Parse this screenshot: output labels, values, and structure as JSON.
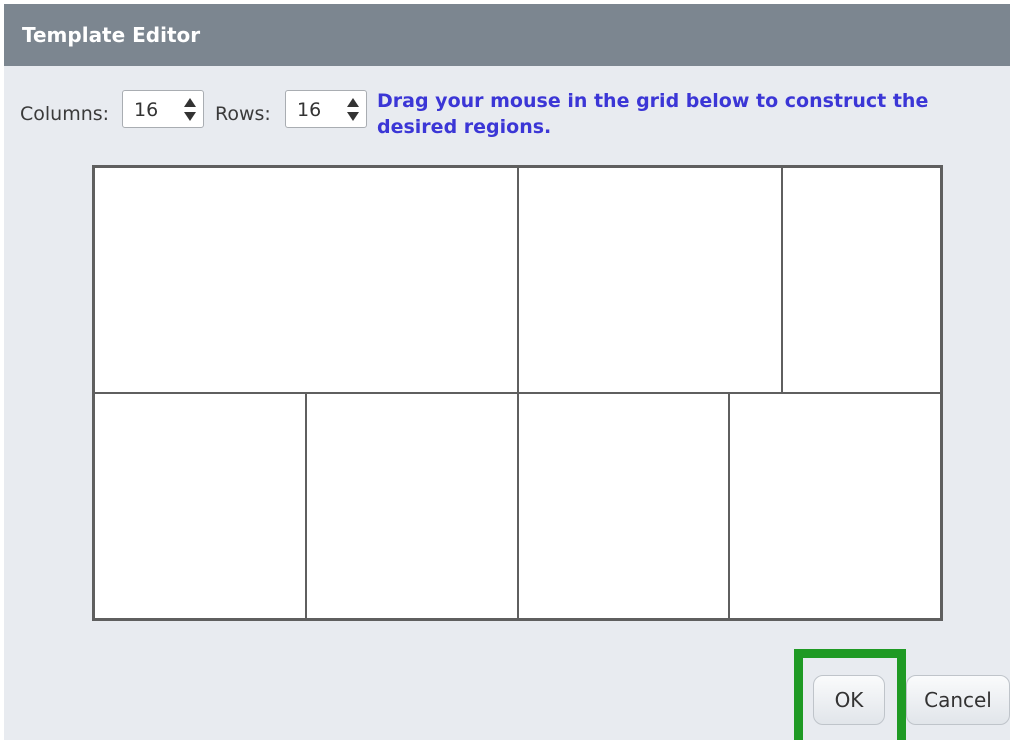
{
  "dialog": {
    "title": "Template Editor"
  },
  "controls": {
    "columns_label": "Columns:",
    "columns_value": "16",
    "rows_label": "Rows:",
    "rows_value": "16",
    "instruction": "Drag your mouse in the grid below to construct the desired regions."
  },
  "grid": {
    "columns": 16,
    "rows": 16,
    "regions": [
      {
        "col": 0,
        "row": 0,
        "colspan": 8,
        "rowspan": 8
      },
      {
        "col": 8,
        "row": 0,
        "colspan": 5,
        "rowspan": 8
      },
      {
        "col": 13,
        "row": 0,
        "colspan": 3,
        "rowspan": 8
      },
      {
        "col": 0,
        "row": 8,
        "colspan": 4,
        "rowspan": 8
      },
      {
        "col": 4,
        "row": 8,
        "colspan": 4,
        "rowspan": 8
      },
      {
        "col": 8,
        "row": 8,
        "colspan": 4,
        "rowspan": 8
      },
      {
        "col": 12,
        "row": 8,
        "colspan": 4,
        "rowspan": 8
      }
    ]
  },
  "buttons": {
    "ok_label": "OK",
    "cancel_label": "Cancel"
  },
  "colors": {
    "titlebar": "#7c8690",
    "dialog_background": "#e8ebf0",
    "instruction_text": "#3b36d6",
    "grid_border": "#5f5f5f",
    "highlight": "#1f9a24"
  }
}
